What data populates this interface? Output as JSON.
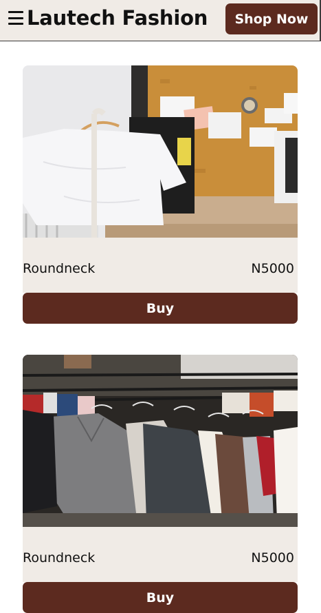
{
  "header": {
    "brand": "Lautech Fashion",
    "cta_label": "Shop Now",
    "menu_icon": "hamburger-icon"
  },
  "products": [
    {
      "name": "Roundneck",
      "price": "N5000",
      "buy_label": "Buy",
      "image": "white t-shirt on hanger rack"
    },
    {
      "name": "Roundneck",
      "price": "N5000",
      "buy_label": "Buy",
      "image": "clothing rack with sweaters"
    }
  ],
  "colors": {
    "accent": "#5c2a1f",
    "panel": "#f0ebe6"
  }
}
